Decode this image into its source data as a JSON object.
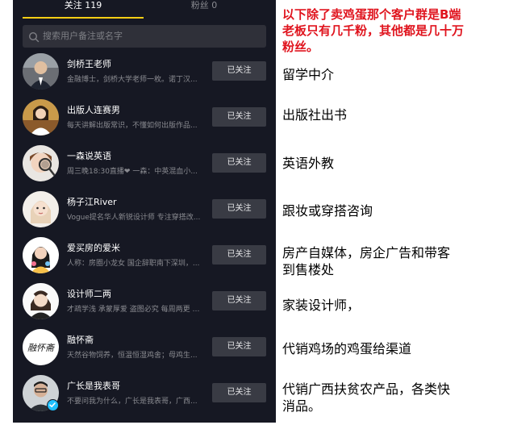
{
  "colors": {
    "background": "#161823",
    "accent_underline": "#face15",
    "button_bg": "#393b44",
    "note_red": "#e0141e",
    "verified_blue": "#20c0ff"
  },
  "tabs": {
    "following_label": "关注 119",
    "fans_label": "粉丝 0"
  },
  "search": {
    "placeholder": "搜索用户备注或名字",
    "icon": "search-icon"
  },
  "users": [
    {
      "name": "剑桥王老师",
      "desc": "金融博士，剑桥大学老师一枚。诺丁汉...",
      "button": "已关注",
      "annotation": "留学中介"
    },
    {
      "name": "出版人连赛男",
      "desc": "每天讲解出版常识，不懂如何出版作品...",
      "button": "已关注",
      "annotation": "出版社出书"
    },
    {
      "name": "一森说英语",
      "desc": "周三晚18:30直播❤ 一森：中英混血小...",
      "button": "已关注",
      "annotation": "英语外教"
    },
    {
      "name": "杨子江River",
      "desc": "Vogue提名华人新锐设计师 专注穿搭改...",
      "button": "已关注",
      "annotation": "跟妆或穿搭咨询"
    },
    {
      "name": "爱买房的爱米",
      "desc": "人称：房圈小龙女 国企辞职南下深圳，...",
      "button": "已关注",
      "annotation": "房产自媒体，房企广告和带客到售楼处"
    },
    {
      "name": "设计师二两",
      "desc": "才疏学浅 承蒙厚爱 盗图必究 每周两更 V...",
      "button": "已关注",
      "annotation": "家装设计师，"
    },
    {
      "name": "融怀斋",
      "desc": "天然谷物饲养，恒温恒湿鸡舍；母鸡生...",
      "button": "已关注",
      "annotation": "代销鸡场的鸡蛋给渠道",
      "avatar_text": "融怀斋"
    },
    {
      "name": "广长是我表哥",
      "desc": "不要问我为什么，广长是我表哥，广西...",
      "button": "已关注",
      "annotation": "代销广西扶贫农产品，各类快消品。",
      "verified": true
    }
  ],
  "note": "以下除了卖鸡蛋那个客户群是B端老板只有几千粉，其他都是几十万粉丝。"
}
